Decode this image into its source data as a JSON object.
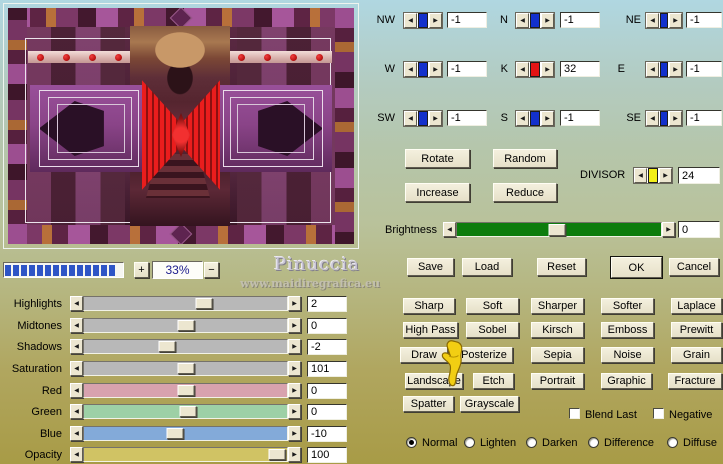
{
  "preview": {
    "zoom_in_label": "+",
    "zoom_value": "33%",
    "zoom_out_label": "−",
    "watermark_line1": "Pinuccia",
    "watermark_line2": "www.maidiregrafica.eu"
  },
  "matrix": {
    "cells": [
      {
        "label": "NW",
        "value": "-1",
        "thumb_color": "#1330cc"
      },
      {
        "label": "N",
        "value": "-1",
        "thumb_color": "#1330cc"
      },
      {
        "label": "NE",
        "value": "-1",
        "thumb_color": "#1330cc"
      },
      {
        "label": "W",
        "value": "-1",
        "thumb_color": "#1330cc"
      },
      {
        "label": "K",
        "value": "32",
        "thumb_color": "#e41414"
      },
      {
        "label": "E",
        "value": "-1",
        "thumb_color": "#1330cc"
      },
      {
        "label": "SW",
        "value": "-1",
        "thumb_color": "#1330cc"
      },
      {
        "label": "S",
        "value": "-1",
        "thumb_color": "#1330cc"
      },
      {
        "label": "SE",
        "value": "-1",
        "thumb_color": "#1330cc"
      }
    ],
    "divisor_label": "DIVISOR",
    "divisor_value": "24",
    "divisor_thumb_color": "#f2ee1a"
  },
  "matrix_actions": {
    "rotate": "Rotate",
    "random": "Random",
    "increase": "Increase",
    "reduce": "Reduce"
  },
  "brightness": {
    "label": "Brightness",
    "value": "0",
    "track_color": "#0d7c0d",
    "thumb_pos": "49%"
  },
  "file_buttons": {
    "save": "Save",
    "load": "Load",
    "reset": "Reset",
    "ok": "OK",
    "cancel": "Cancel"
  },
  "filter_buttons": [
    [
      "Sharp",
      "Soft",
      "Sharper",
      "Softer",
      "Laplace"
    ],
    [
      "High Pass",
      "Sobel",
      "Kirsch",
      "Emboss",
      "Prewitt"
    ],
    [
      "Draw",
      "Posterize",
      "Sepia",
      "Noise",
      "Grain"
    ],
    [
      "Landscape",
      "Etch",
      "Portrait",
      "Graphic",
      "Fracture"
    ],
    [
      "Spatter",
      "Grayscale"
    ]
  ],
  "toggles": {
    "blend_last": "Blend Last",
    "negative": "Negative"
  },
  "blend_modes": {
    "options": [
      "Normal",
      "Lighten",
      "Darken",
      "Difference",
      "Diffuse"
    ],
    "selected": "Normal"
  },
  "adjust_sliders": [
    {
      "label": "Highlights",
      "value": "2",
      "track_color": "#b8b8b8",
      "thumb_pos": "59%"
    },
    {
      "label": "Midtones",
      "value": "0",
      "track_color": "#b8b8b8",
      "thumb_pos": "50%"
    },
    {
      "label": "Shadows",
      "value": "-2",
      "track_color": "#b8b8b8",
      "thumb_pos": "41%"
    },
    {
      "label": "Saturation",
      "value": "101",
      "track_color": "#b8b8b8",
      "thumb_pos": "50%"
    },
    {
      "label": "Red",
      "value": "0",
      "track_color": "#d8a2ae",
      "thumb_pos": "50%"
    },
    {
      "label": "Green",
      "value": "0",
      "track_color": "#9dd0a6",
      "thumb_pos": "51%"
    },
    {
      "label": "Blue",
      "value": "-10",
      "track_color": "#83aad9",
      "thumb_pos": "45%"
    },
    {
      "label": "Opacity",
      "value": "100",
      "track_color": "#d0c364",
      "thumb_pos": "95%"
    }
  ]
}
